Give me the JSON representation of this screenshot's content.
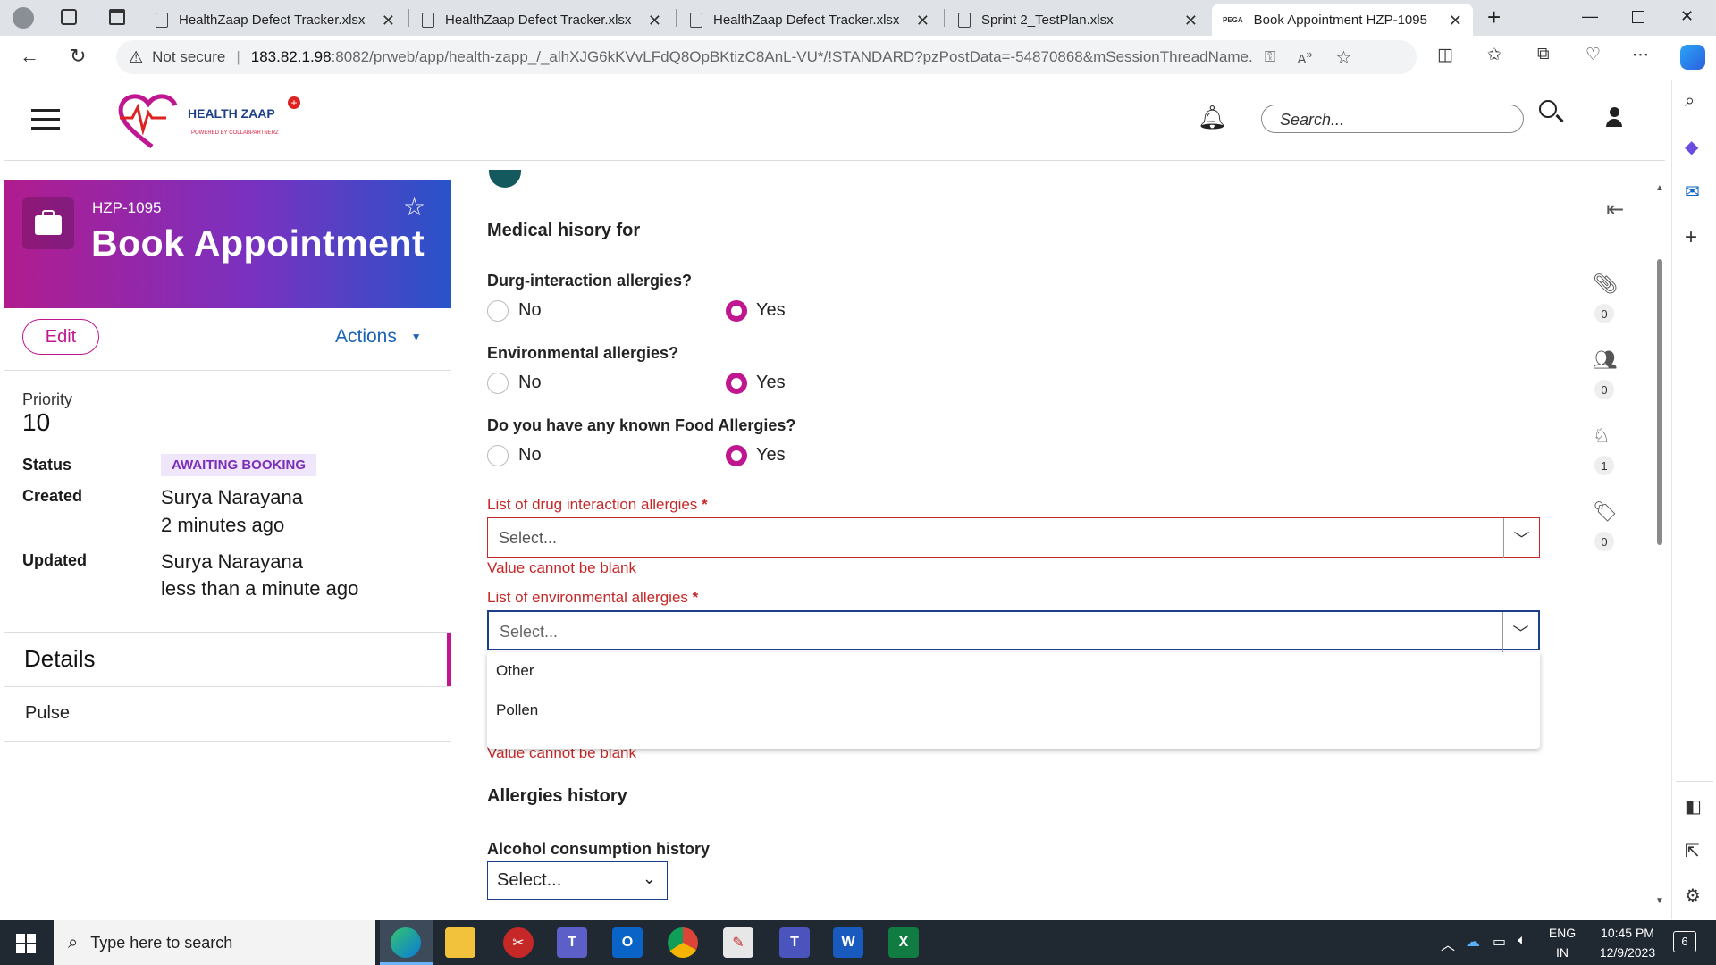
{
  "browser": {
    "tabs": [
      {
        "title": "HealthZaap Defect Tracker.xlsx"
      },
      {
        "title": "HealthZaap Defect Tracker.xlsx"
      },
      {
        "title": "HealthZaap Defect Tracker.xlsx"
      },
      {
        "title": "Sprint 2_TestPlan.xlsx"
      },
      {
        "title": "Book Appointment HZP-1095",
        "favicon_text": "PEGA"
      }
    ],
    "security_label": "Not secure",
    "url_host": "183.82.1.98",
    "url_rest": ":8082/prweb/app/health-zapp_/_alhXJG6kKVvLFdQ8OpBKtizC8AnL-VU*/!STANDARD?pzPostData=-54870868&mSessionThreadName..."
  },
  "header": {
    "logo_text": "HEALTH ZAAP",
    "logo_sub": "POWERED BY COLLABPARTNERZ",
    "search_placeholder": "Search..."
  },
  "case": {
    "id": "HZP-1095",
    "title": "Book Appointment",
    "edit_label": "Edit",
    "actions_label": "Actions",
    "priority_label": "Priority",
    "priority_value": "10",
    "status_label": "Status",
    "status_value": "AWAITING BOOKING",
    "created_label": "Created",
    "created_by": "Surya Narayana",
    "created_when": "2 minutes ago",
    "updated_label": "Updated",
    "updated_by": "Surya Narayana",
    "updated_when": "less than a minute ago",
    "details_heading": "Details",
    "details_item": "Pulse"
  },
  "form": {
    "section_title": "Medical hisory for",
    "q1": "Durg-interaction allergies?",
    "q2": "Environmental allergies?",
    "q3": "Do you have any known Food Allergies?",
    "no_label": "No",
    "yes_label": "Yes",
    "drug_list_label": "List of drug interaction allergies",
    "env_list_label": "List of environmental allergies",
    "select_placeholder": "Select...",
    "error_text": "Value cannot be blank",
    "dropdown_options": [
      "Other",
      "Pollen"
    ],
    "allergies_history_heading": "Allergies history",
    "alcohol_label": "Alcohol consumption history",
    "alcohol_value": "Select..."
  },
  "rail": {
    "attachments_count": "0",
    "followers_count": "0",
    "stakeholders_count": "1",
    "tags_count": "0"
  },
  "taskbar": {
    "search_placeholder": "Type here to search",
    "lang_top": "ENG",
    "lang_bottom": "IN",
    "time": "10:45 PM",
    "date": "12/9/2023",
    "notif_count": "6"
  },
  "colors": {
    "accent": "#c0168f",
    "error": "#c62828",
    "focus": "#1c3f8a"
  }
}
